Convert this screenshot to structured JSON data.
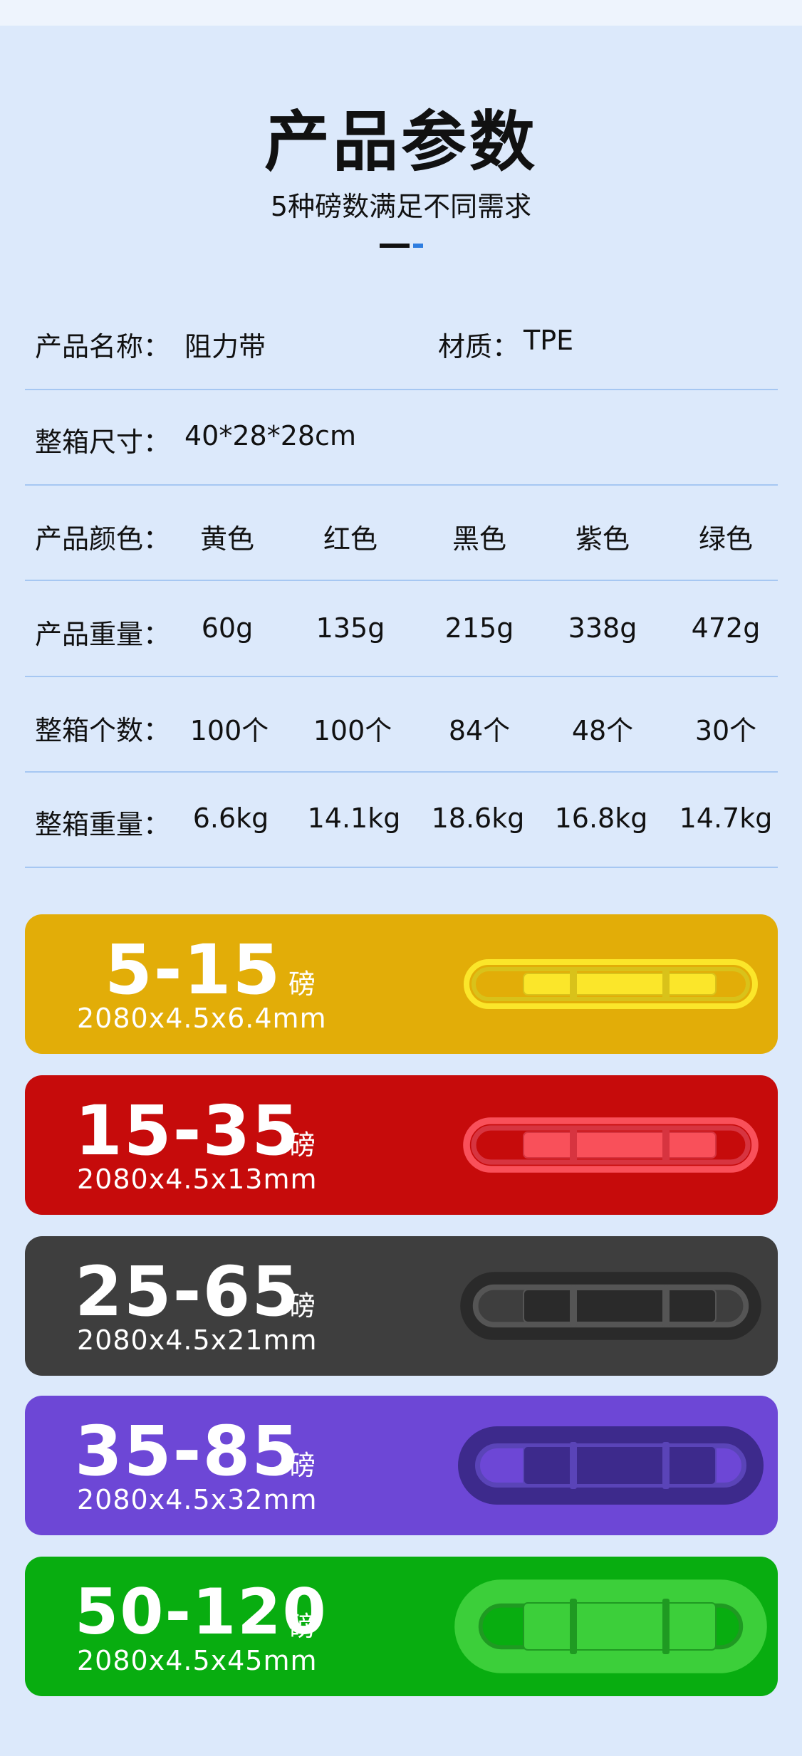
{
  "header": {
    "title": "产品参数",
    "subtitle": "5种磅数满足不同需求"
  },
  "specs": {
    "name_label": "产品名称：",
    "name_value": "阻力带",
    "material_label": "材质：",
    "material_value": "TPE",
    "box_size_label": "整箱尺寸：",
    "box_size_value": "40*28*28cm",
    "color_label": "产品颜色：",
    "colors": [
      "黄色",
      "红色",
      "黑色",
      "紫色",
      "绿色"
    ],
    "weight_label": "产品重量：",
    "weights": [
      "60g",
      "135g",
      "215g",
      "338g",
      "472g"
    ],
    "count_label": "整箱个数：",
    "counts": [
      "100个",
      "100个",
      "84个",
      "48个",
      "30个"
    ],
    "box_weight_label": "整箱重量：",
    "box_weights": [
      "6.6kg",
      "14.1kg",
      "18.6kg",
      "16.8kg",
      "14.7kg"
    ]
  },
  "bands": [
    {
      "range": "5-15",
      "unit": "磅",
      "dims": "2080x4.5x6.4mm",
      "bg": "#e2ad08",
      "band_color": "#fbe62a",
      "band_shade": "#d9c21a",
      "thickness": 6
    },
    {
      "range": "15-35",
      "unit": "磅",
      "dims": "2080x4.5x13mm",
      "bg": "#c60b0b",
      "band_color": "#f9505a",
      "band_shade": "#d73440",
      "thickness": 12
    },
    {
      "range": "25-65",
      "unit": "磅",
      "dims": "2080x4.5x21mm",
      "bg": "#3e3e3e",
      "band_color": "#2a2a2a",
      "band_shade": "#555555",
      "thickness": 22
    },
    {
      "range": "35-85",
      "unit": "磅",
      "dims": "2080x4.5x32mm",
      "bg": "#6d47d6",
      "band_color": "#3d2a8c",
      "band_shade": "#5a44b8",
      "thickness": 30
    },
    {
      "range": "50-120",
      "unit": "磅",
      "dims": "2080x4.5x45mm",
      "bg": "#08ad10",
      "band_color": "#3ccf3a",
      "band_shade": "#1f9a22",
      "thickness": 42
    }
  ]
}
